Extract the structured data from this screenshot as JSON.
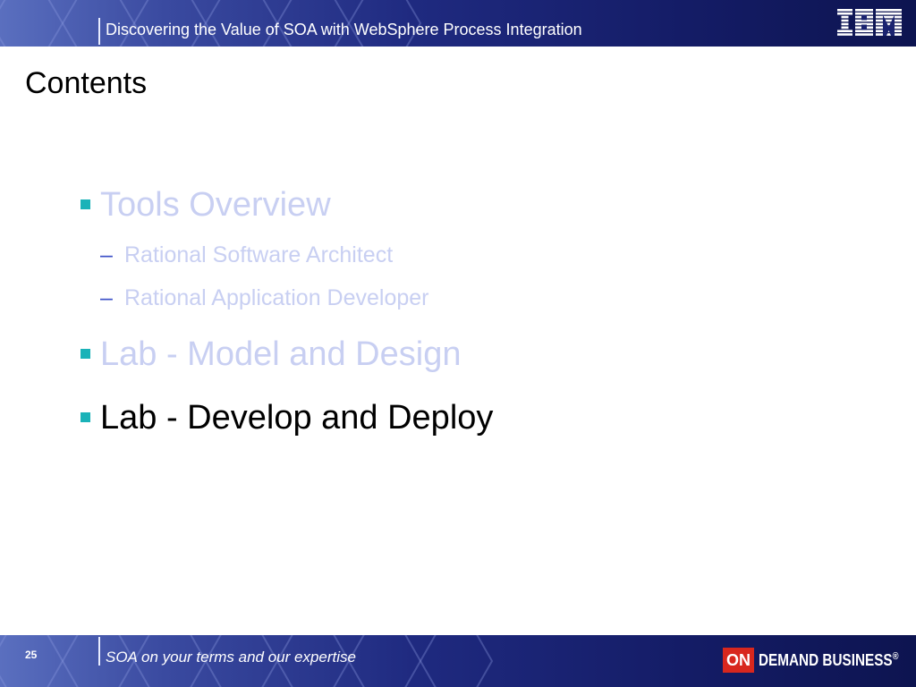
{
  "header": {
    "title": "Discovering the Value of SOA with WebSphere Process Integration",
    "logo_text": "IBM"
  },
  "page": {
    "title": "Contents"
  },
  "agenda": {
    "items": [
      {
        "label": "Tools Overview",
        "level": 1,
        "state": "dimmed"
      },
      {
        "label": "Rational Software Architect",
        "level": 2,
        "state": "dimmed"
      },
      {
        "label": "Rational Application Developer",
        "level": 2,
        "state": "dimmed"
      },
      {
        "label": "Lab - Model and Design",
        "level": 1,
        "state": "dimmed"
      },
      {
        "label": "Lab - Develop and Deploy",
        "level": 1,
        "state": "active"
      }
    ],
    "sub_marker": "–"
  },
  "footer": {
    "page_number": "25",
    "tagline": "SOA on your terms and our expertise",
    "logo_on": "ON",
    "logo_text": "DEMAND BUSINESS",
    "trademark": "®"
  },
  "colors": {
    "band_dark": "#141c66",
    "band_light": "#5a6fbf",
    "bullet": "#1ab2b8",
    "sub_marker": "#3b4fc7",
    "dimmed_text": "#c8cff2",
    "active_text": "#000000",
    "logo_red": "#d8271e"
  }
}
